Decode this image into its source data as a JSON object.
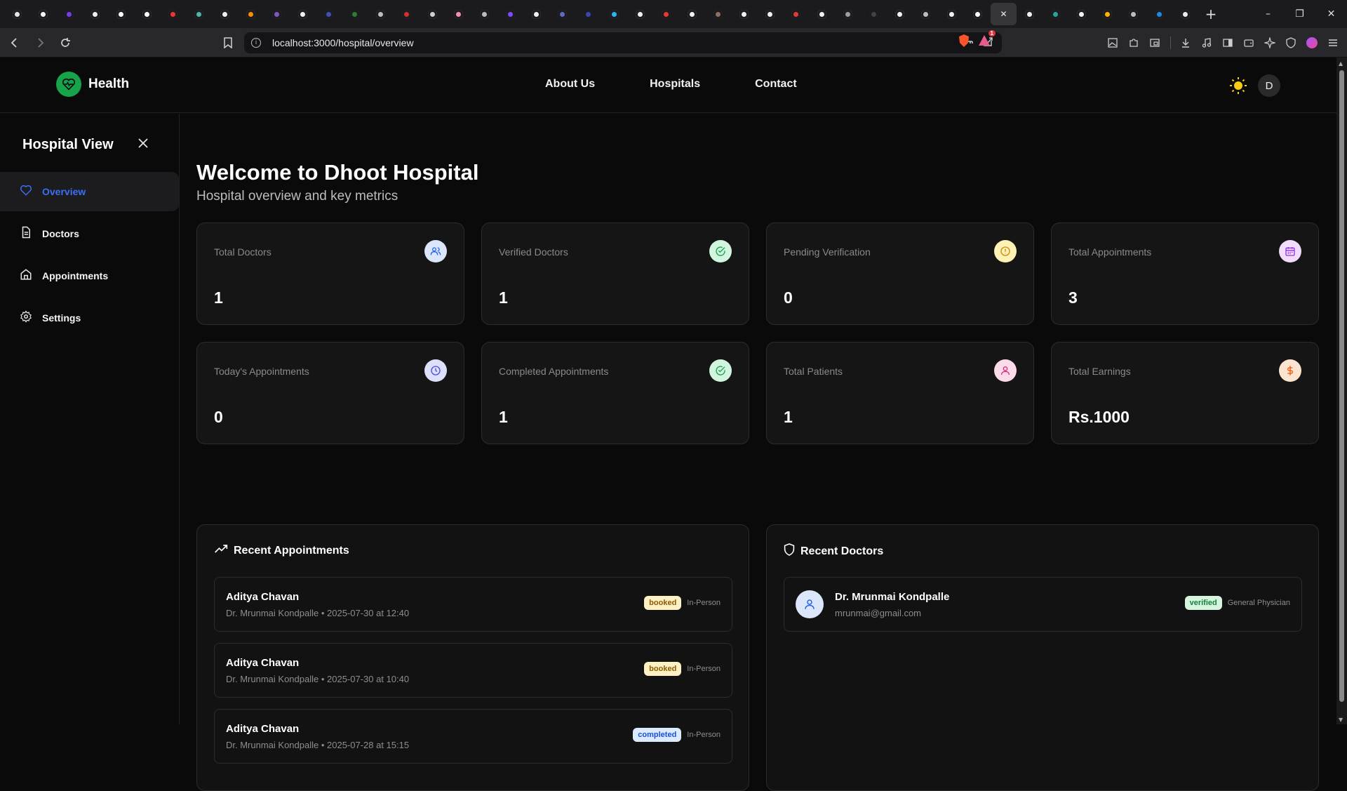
{
  "browser": {
    "url": "localhost:3000/hospital/overview",
    "tab_favicons": [
      "speaker-icon",
      "github-icon",
      "arc-icon",
      "slash-icon",
      "circle-icon",
      "circle-icon",
      "youtube-icon",
      "triangle-icon",
      "github-icon",
      "orange-icon",
      "react-icon",
      "p-icon",
      "blue-circle-icon",
      "green-icon",
      "gear-icon",
      "ring-icon",
      "swirl-icon",
      "pink-icon",
      "gear-icon",
      "purple-icon",
      "a-icon",
      "hash-icon",
      "ui-icon",
      "tailwind-icon",
      "brand-icon",
      "red-icon",
      "brand-icon",
      "face-icon",
      "google-icon",
      "github-icon",
      "youtube-icon",
      "github-icon",
      "frame-icon",
      "moon-icon",
      "github-icon",
      "globe-icon",
      "x-icon",
      "triangle-icon",
      "close-icon",
      "x-icon",
      "teal-icon",
      "x-icon",
      "colors-icon",
      "slash-icon",
      "f-icon",
      "cloud-icon"
    ],
    "window_controls": {
      "minimize": "–",
      "restore": "❐",
      "close": "✕"
    },
    "brave_badge": "1"
  },
  "app": {
    "brand": "Health",
    "nav": [
      "About Us",
      "Hospitals",
      "Contact"
    ],
    "avatar_initial": "D"
  },
  "sidebar": {
    "title": "Hospital View",
    "items": [
      {
        "label": "Overview",
        "icon": "heart-icon",
        "active": true
      },
      {
        "label": "Doctors",
        "icon": "document-icon",
        "active": false
      },
      {
        "label": "Appointments",
        "icon": "home-icon",
        "active": false
      },
      {
        "label": "Settings",
        "icon": "gear-icon",
        "active": false
      }
    ]
  },
  "main": {
    "title": "Welcome to Dhoot Hospital",
    "subtitle": "Hospital overview and key metrics",
    "stats": [
      {
        "label": "Total Doctors",
        "value": "1",
        "icon": "users-icon",
        "color": "#dbe6fb"
      },
      {
        "label": "Verified Doctors",
        "value": "1",
        "icon": "check-circle-icon",
        "color": "#d1f5df"
      },
      {
        "label": "Pending Verification",
        "value": "0",
        "icon": "alert-circle-icon",
        "color": "#fdf1b6"
      },
      {
        "label": "Total Appointments",
        "value": "3",
        "icon": "calendar-icon",
        "color": "#f1dcfb"
      },
      {
        "label": "Today's Appointments",
        "value": "0",
        "icon": "clock-icon",
        "color": "#dbe0fb"
      },
      {
        "label": "Completed Appointments",
        "value": "1",
        "icon": "check-circle-icon",
        "color": "#d1f5df"
      },
      {
        "label": "Total Patients",
        "value": "1",
        "icon": "user-icon",
        "color": "#fbdbe9"
      },
      {
        "label": "Total Earnings",
        "value": "Rs.1000",
        "icon": "dollar-icon",
        "color": "#fde4cf"
      }
    ],
    "recent_appointments": {
      "title": "Recent Appointments",
      "rows": [
        {
          "patient": "Aditya Chavan",
          "detail": "Dr. Mrunmai Kondpalle • 2025-07-30 at 12:40",
          "status": "booked",
          "mode": "In-Person"
        },
        {
          "patient": "Aditya Chavan",
          "detail": "Dr. Mrunmai Kondpalle • 2025-07-30 at 10:40",
          "status": "booked",
          "mode": "In-Person"
        },
        {
          "patient": "Aditya Chavan",
          "detail": "Dr. Mrunmai Kondpalle • 2025-07-28 at 15:15",
          "status": "completed",
          "mode": "In-Person"
        }
      ]
    },
    "recent_doctors": {
      "title": "Recent Doctors",
      "rows": [
        {
          "name": "Dr. Mrunmai Kondpalle",
          "email": "mrunmai@gmail.com",
          "status": "verified",
          "specialty": "General Physician"
        }
      ]
    }
  }
}
